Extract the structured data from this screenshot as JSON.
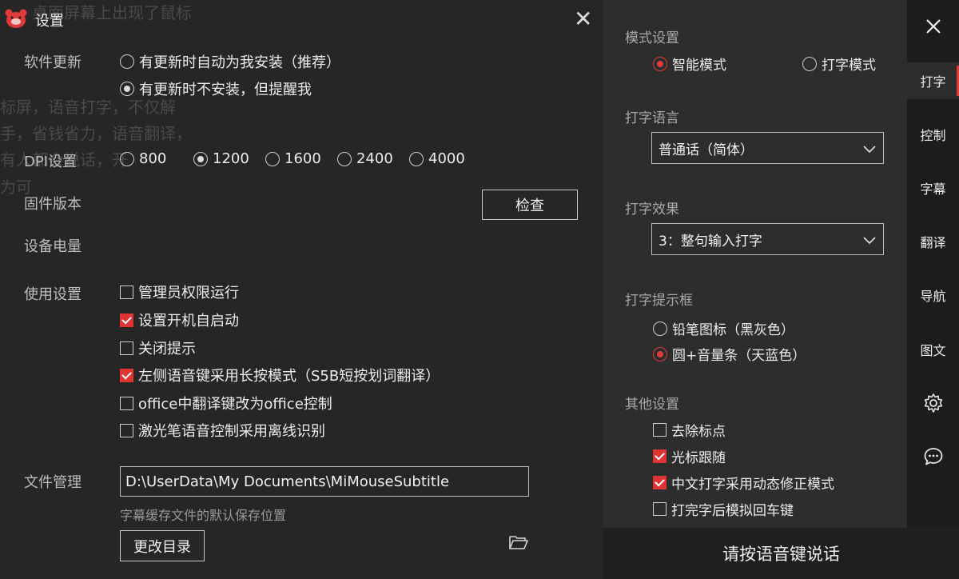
{
  "background_text": {
    "line1": "桌面屏幕上出现了鼠标",
    "line2": "标屏，语音打字，不仅解",
    "line3": "手，省钱省力，语音翻译，",
    "line4": "有人都会说话，开",
    "line5": "为可"
  },
  "window": {
    "title": "设置"
  },
  "software_update": {
    "label": "软件更新",
    "options": [
      {
        "label": "有更新时自动为我安装（推荐）",
        "selected": false
      },
      {
        "label": "有更新时不安装，但提醒我",
        "selected": true
      }
    ]
  },
  "dpi": {
    "label": "DPI设置",
    "options": [
      {
        "label": "800",
        "selected": false
      },
      {
        "label": "1200",
        "selected": true
      },
      {
        "label": "1600",
        "selected": false
      },
      {
        "label": "2400",
        "selected": false
      },
      {
        "label": "4000",
        "selected": false
      }
    ]
  },
  "firmware": {
    "label": "固件版本",
    "check_button": "检查"
  },
  "battery": {
    "label": "设备电量"
  },
  "usage": {
    "label": "使用设置",
    "options": [
      {
        "label": "管理员权限运行",
        "checked": false
      },
      {
        "label": "设置开机自启动",
        "checked": true
      },
      {
        "label": "关闭提示",
        "checked": false
      },
      {
        "label": "左侧语音键采用长按模式（S5B短按划词翻译）",
        "checked": true
      },
      {
        "label": "office中翻译键改为office控制",
        "checked": false
      },
      {
        "label": "激光笔语音控制采用离线识别",
        "checked": false
      }
    ]
  },
  "file_management": {
    "label": "文件管理",
    "path": "D:\\UserData\\My Documents\\MiMouseSubtitle",
    "hint": "字幕缓存文件的默认保存位置",
    "change_button": "更改目录"
  },
  "right_panel": {
    "mode": {
      "label": "模式设置",
      "options": [
        {
          "label": "智能模式",
          "selected": true
        },
        {
          "label": "打字模式",
          "selected": false
        }
      ]
    },
    "language": {
      "label": "打字语言",
      "value": "普通话（简体）"
    },
    "effect": {
      "label": "打字效果",
      "value": "3：整句输入打字"
    },
    "prompt_box": {
      "label": "打字提示框",
      "options": [
        {
          "label": "铅笔图标（黑灰色）",
          "selected": false
        },
        {
          "label": "圆+音量条（天蓝色）",
          "selected": true
        }
      ]
    },
    "other": {
      "label": "其他设置",
      "options": [
        {
          "label": "去除标点",
          "checked": false
        },
        {
          "label": "光标跟随",
          "checked": true
        },
        {
          "label": "中文打字采用动态修正模式",
          "checked": true
        },
        {
          "label": "打完字后模拟回车键",
          "checked": false
        }
      ]
    }
  },
  "side_nav": {
    "items": [
      {
        "label": "打字",
        "active": true
      },
      {
        "label": "控制",
        "active": false
      },
      {
        "label": "字幕",
        "active": false
      },
      {
        "label": "翻译",
        "active": false
      },
      {
        "label": "导航",
        "active": false
      },
      {
        "label": "图文",
        "active": false
      }
    ]
  },
  "speak_bar": {
    "label": "请按语音键说话"
  },
  "colors": {
    "accent": "#e23a3a",
    "panel": "#2d2d2d",
    "nav": "#1c1c1c"
  }
}
